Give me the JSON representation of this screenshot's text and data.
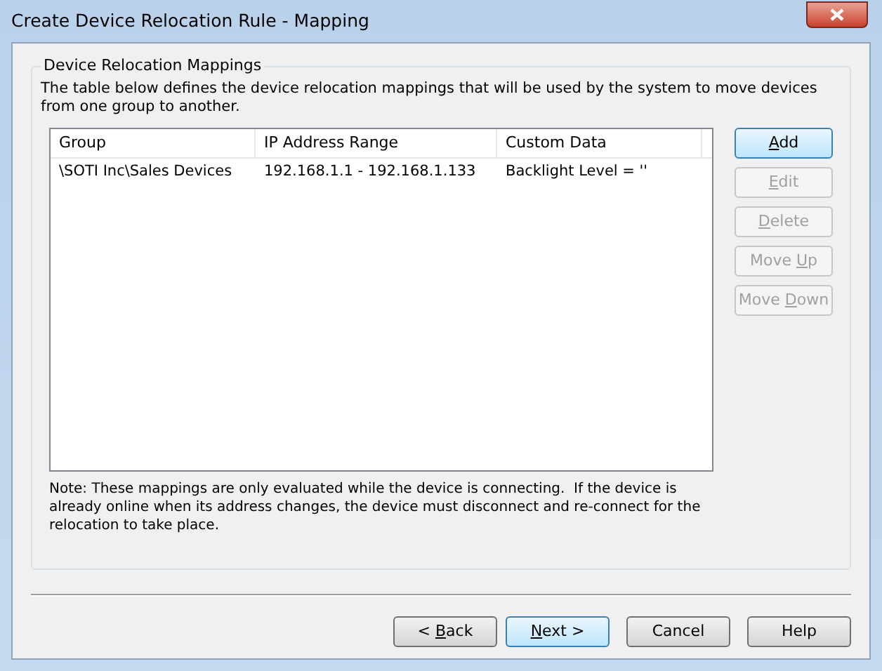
{
  "window": {
    "title": "Create Device Relocation Rule - Mapping"
  },
  "group": {
    "title": "Device Relocation Mappings",
    "description": "The table below defines the device relocation mappings that will be used by the system to move devices from one group to another.",
    "table": {
      "columns": [
        "Group",
        "IP Address Range",
        "Custom Data"
      ],
      "rows": [
        {
          "cells": [
            "\\SOTI Inc\\Sales Devices",
            "192.168.1.1 - 192.168.1.133",
            "Backlight Level = ''"
          ],
          "selected": false
        }
      ]
    },
    "buttons": [
      {
        "access_key": "A",
        "text_after": "dd",
        "disabled": false,
        "default": true
      },
      {
        "access_key": "E",
        "text_after": "dit",
        "disabled": true,
        "default": false
      },
      {
        "access_key": "D",
        "text_after": "elete",
        "disabled": true,
        "default": false
      },
      {
        "text_before": "Move ",
        "access_key": "U",
        "text_after": "p",
        "disabled": true,
        "default": false
      },
      {
        "text_before": "Move ",
        "access_key": "D",
        "text_after": "own",
        "disabled": true,
        "default": false
      }
    ],
    "note": "Note: These mappings are only evaluated while the device is connecting.  If the device is already online when its address changes, the device must disconnect and re-connect for the relocation to take place."
  },
  "footer_buttons": [
    {
      "text_before": "< ",
      "access_key": "B",
      "text_after": "ack",
      "disabled": false,
      "default": false
    },
    {
      "access_key": "N",
      "text_after": "ext >",
      "disabled": false,
      "default": true
    },
    {
      "label": "Cancel",
      "disabled": false,
      "default": false
    },
    {
      "label": "Help",
      "disabled": false,
      "default": false
    }
  ]
}
